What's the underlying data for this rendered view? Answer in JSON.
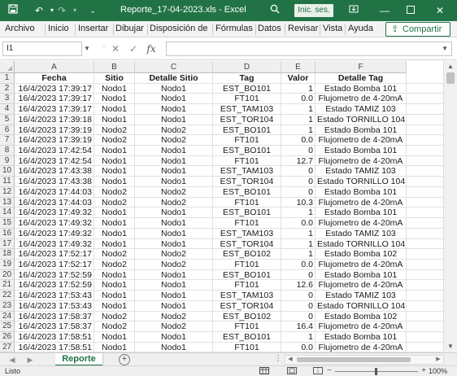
{
  "window": {
    "title": "Reporte_17-04-2023.xls  -  Excel",
    "signin_label": "Inic. ses."
  },
  "menu": {
    "tabs": [
      "Archivo",
      "Inicio",
      "Insertar",
      "Dibujar",
      "Disposición de",
      "Fórmulas",
      "Datos",
      "Revisar",
      "Vista",
      "Ayuda"
    ],
    "share_label": "Compartir"
  },
  "formula_bar": {
    "name_box": "I1",
    "formula": ""
  },
  "grid": {
    "columns": [
      "A",
      "B",
      "C",
      "D",
      "E",
      "F"
    ],
    "header_row": [
      "Fecha",
      "Sitio",
      "Detalle Sitio",
      "Tag",
      "Valor",
      "Detalle Tag"
    ],
    "rows": [
      [
        "16/4/2023 17:39:17",
        "Nodo1",
        "Nodo1",
        "EST_BO101",
        "1",
        "Estado Bomba 101"
      ],
      [
        "16/4/2023 17:39:17",
        "Nodo1",
        "Nodo1",
        "FT101",
        "0.0",
        "Flujometro de 4-20mA"
      ],
      [
        "16/4/2023 17:39:17",
        "Nodo1",
        "Nodo1",
        "EST_TAM103",
        "1",
        "Estado TAMIZ 103"
      ],
      [
        "16/4/2023 17:39:18",
        "Nodo1",
        "Nodo1",
        "EST_TOR104",
        "1",
        "Estado TORNILLO 104"
      ],
      [
        "16/4/2023 17:39:19",
        "Nodo2",
        "Nodo2",
        "EST_BO101",
        "1",
        "Estado Bomba 101"
      ],
      [
        "16/4/2023 17:39:19",
        "Nodo2",
        "Nodo2",
        "FT101",
        "0.0",
        "Flujometro de 4-20mA"
      ],
      [
        "16/4/2023 17:42:54",
        "Nodo1",
        "Nodo1",
        "EST_BO101",
        "0",
        "Estado Bomba 101"
      ],
      [
        "16/4/2023 17:42:54",
        "Nodo1",
        "Nodo1",
        "FT101",
        "12.7",
        "Flujometro de 4-20mA"
      ],
      [
        "16/4/2023 17:43:38",
        "Nodo1",
        "Nodo1",
        "EST_TAM103",
        "0",
        "Estado TAMIZ 103"
      ],
      [
        "16/4/2023 17:43:38",
        "Nodo1",
        "Nodo1",
        "EST_TOR104",
        "0",
        "Estado TORNILLO 104"
      ],
      [
        "16/4/2023 17:44:03",
        "Nodo2",
        "Nodo2",
        "EST_BO101",
        "0",
        "Estado Bomba 101"
      ],
      [
        "16/4/2023 17:44:03",
        "Nodo2",
        "Nodo2",
        "FT101",
        "10.3",
        "Flujometro de 4-20mA"
      ],
      [
        "16/4/2023 17:49:32",
        "Nodo1",
        "Nodo1",
        "EST_BO101",
        "1",
        "Estado Bomba 101"
      ],
      [
        "16/4/2023 17:49:32",
        "Nodo1",
        "Nodo1",
        "FT101",
        "0.0",
        "Flujometro de 4-20mA"
      ],
      [
        "16/4/2023 17:49:32",
        "Nodo1",
        "Nodo1",
        "EST_TAM103",
        "1",
        "Estado TAMIZ 103"
      ],
      [
        "16/4/2023 17:49:32",
        "Nodo1",
        "Nodo1",
        "EST_TOR104",
        "1",
        "Estado TORNILLO 104"
      ],
      [
        "16/4/2023 17:52:17",
        "Nodo2",
        "Nodo2",
        "EST_BO102",
        "1",
        "Estado Bomba 102"
      ],
      [
        "16/4/2023 17:52:17",
        "Nodo2",
        "Nodo2",
        "FT101",
        "0.0",
        "Flujometro de 4-20mA"
      ],
      [
        "16/4/2023 17:52:59",
        "Nodo1",
        "Nodo1",
        "EST_BO101",
        "0",
        "Estado Bomba 101"
      ],
      [
        "16/4/2023 17:52:59",
        "Nodo1",
        "Nodo1",
        "FT101",
        "12.6",
        "Flujometro de 4-20mA"
      ],
      [
        "16/4/2023 17:53:43",
        "Nodo1",
        "Nodo1",
        "EST_TAM103",
        "0",
        "Estado TAMIZ 103"
      ],
      [
        "16/4/2023 17:53:43",
        "Nodo1",
        "Nodo1",
        "EST_TOR104",
        "0",
        "Estado TORNILLO 104"
      ],
      [
        "16/4/2023 17:58:37",
        "Nodo2",
        "Nodo2",
        "EST_BO102",
        "0",
        "Estado Bomba 102"
      ],
      [
        "16/4/2023 17:58:37",
        "Nodo2",
        "Nodo2",
        "FT101",
        "16.4",
        "Flujometro de 4-20mA"
      ],
      [
        "16/4/2023 17:58:51",
        "Nodo1",
        "Nodo1",
        "EST_BO101",
        "1",
        "Estado Bomba 101"
      ],
      [
        "16/4/2023 17:58:51",
        "Nodo1",
        "Nodo1",
        "FT101",
        "0.0",
        "Flujometro de 4-20mA"
      ]
    ]
  },
  "sheets": {
    "active_tab": "Reporte"
  },
  "status": {
    "text": "Listo",
    "zoom": "100%"
  },
  "icons": {
    "save": "save-icon",
    "undo": "undo-icon",
    "redo": "redo-icon",
    "search": "search-icon",
    "share": "share-icon"
  },
  "colors": {
    "accent": "#217346"
  }
}
